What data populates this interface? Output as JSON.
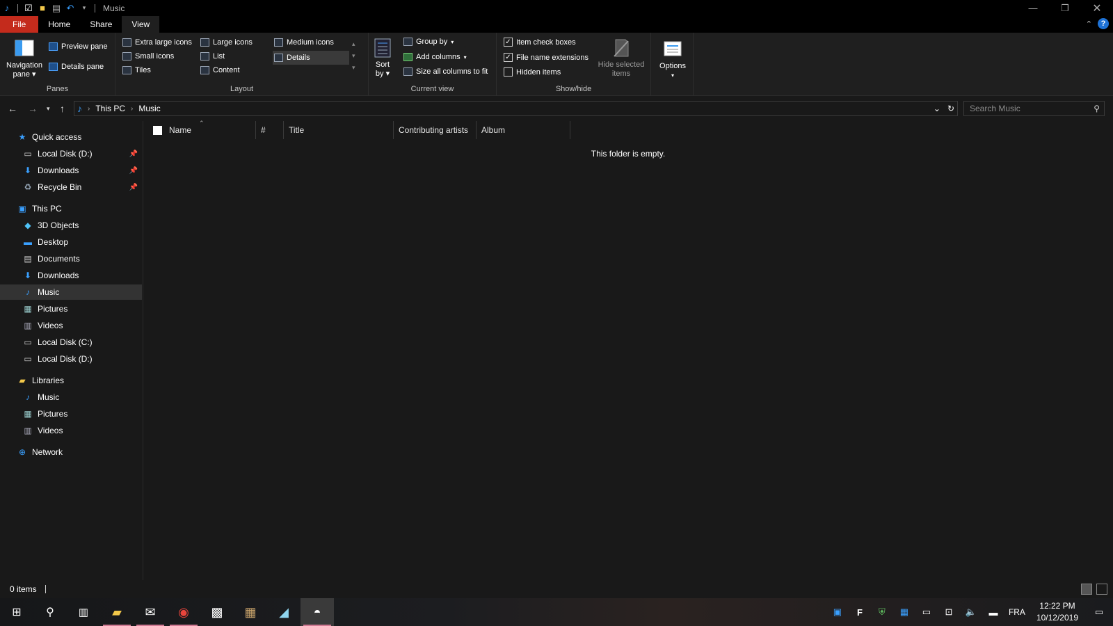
{
  "window": {
    "title": "Music",
    "controls": [
      "minimize-icon",
      "restore-icon",
      "close-icon"
    ]
  },
  "ribbon_tabs": {
    "file": "File",
    "home": "Home",
    "share": "Share",
    "view": "View"
  },
  "ribbon": {
    "panes": {
      "label": "Panes",
      "navigation_pane_line1": "Navigation",
      "navigation_pane_line2": "pane",
      "preview_pane": "Preview pane",
      "details_pane": "Details pane"
    },
    "layout": {
      "label": "Layout",
      "extra_large_icons": "Extra large icons",
      "large_icons": "Large icons",
      "medium_icons": "Medium icons",
      "small_icons": "Small icons",
      "list": "List",
      "details": "Details",
      "tiles": "Tiles",
      "content": "Content"
    },
    "current_view": {
      "label": "Current view",
      "sort_by_line1": "Sort",
      "sort_by_line2": "by",
      "group_by": "Group by",
      "add_columns": "Add columns",
      "size_all_columns": "Size all columns to fit"
    },
    "show_hide": {
      "label": "Show/hide",
      "item_check_boxes": "Item check boxes",
      "file_name_extensions": "File name extensions",
      "hidden_items": "Hidden items",
      "hide_selected_line1": "Hide selected",
      "hide_selected_line2": "items",
      "item_check_boxes_checked": true,
      "file_name_extensions_checked": true,
      "hidden_items_checked": false
    },
    "options": {
      "label": "Options"
    }
  },
  "address": {
    "crumbs": [
      "This PC",
      "Music"
    ],
    "search_placeholder": "Search Music"
  },
  "sidebar": {
    "quick_access": "Quick access",
    "quick_items": [
      "Local Disk (D:)",
      "Downloads",
      "Recycle Bin"
    ],
    "this_pc": "This PC",
    "pc_items": [
      "3D Objects",
      "Desktop",
      "Documents",
      "Downloads",
      "Music",
      "Pictures",
      "Videos",
      "Local Disk (C:)",
      "Local Disk (D:)"
    ],
    "libraries": "Libraries",
    "lib_items": [
      "Music",
      "Pictures",
      "Videos"
    ],
    "network": "Network",
    "selected": "Music"
  },
  "columns": {
    "name": "Name",
    "number": "#",
    "title": "Title",
    "artists": "Contributing artists",
    "album": "Album"
  },
  "empty_message": "This folder is empty.",
  "status": {
    "items": "0 items"
  },
  "taskbar": {
    "language": "FRA",
    "time": "12:22 PM",
    "date": "10/12/2019"
  },
  "colors": {
    "accent": "#c42b1c",
    "selection": "#333333",
    "background": "#191919"
  }
}
